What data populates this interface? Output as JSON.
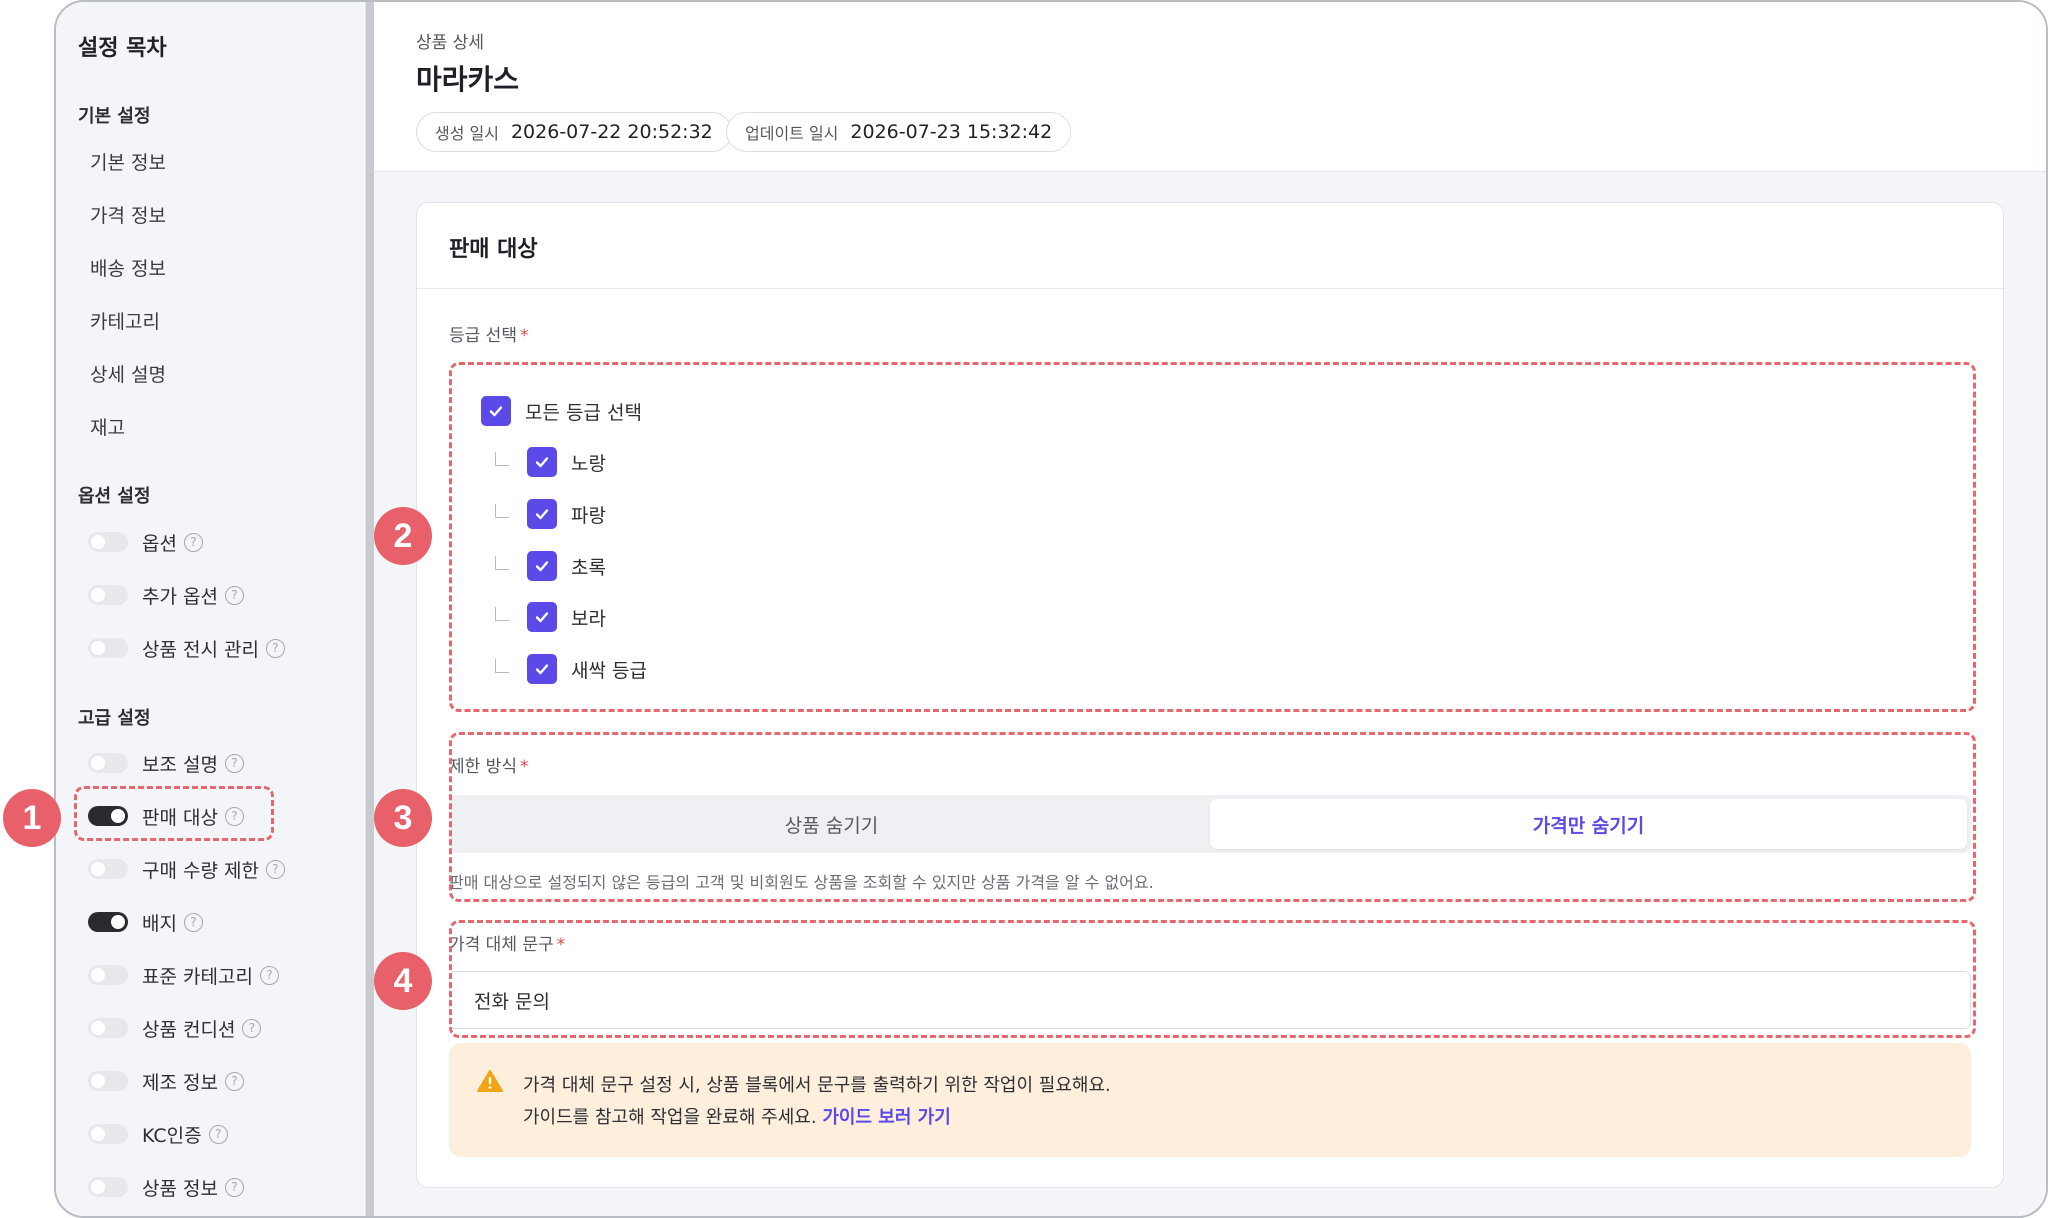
{
  "sidebar": {
    "title": "설정 목차",
    "basic_section": "기본 설정",
    "basic_items": [
      "기본 정보",
      "가격 정보",
      "배송 정보",
      "카테고리",
      "상세 설명",
      "재고"
    ],
    "option_section": "옵션 설정",
    "option_items": [
      {
        "label": "옵션",
        "on": false
      },
      {
        "label": "추가 옵션",
        "on": false
      },
      {
        "label": "상품 전시 관리",
        "on": false
      }
    ],
    "advanced_section": "고급 설정",
    "advanced_items": [
      {
        "label": "보조 설명",
        "on": false
      },
      {
        "label": "판매 대상",
        "on": true
      },
      {
        "label": "구매 수량 제한",
        "on": false
      },
      {
        "label": "배지",
        "on": true
      },
      {
        "label": "표준 카테고리",
        "on": false
      },
      {
        "label": "상품 컨디션",
        "on": false
      },
      {
        "label": "제조 정보",
        "on": false
      },
      {
        "label": "KC인증",
        "on": false
      },
      {
        "label": "상품 정보",
        "on": false
      }
    ],
    "help_glyph": "?"
  },
  "header": {
    "breadcrumb": "상품 상세",
    "title": "마라카스",
    "created_label": "생성 일시",
    "created_value": "2026-07-22 20:52:32",
    "updated_label": "업데이트 일시",
    "updated_value": "2026-07-23 15:32:42"
  },
  "card": {
    "title": "판매 대상",
    "grade_label": "등급 선택",
    "required_mark": "*",
    "all_grades": "모든 등급 선택",
    "grades": [
      "노랑",
      "파랑",
      "초록",
      "보라",
      "새싹 등급"
    ],
    "restriction_label": "제한 방식",
    "seg_options": [
      "상품 숨기기",
      "가격만 숨기기"
    ],
    "seg_selected": "가격만 숨기기",
    "hint": "판매 대상으로 설정되지 않은 등급의 고객 및 비회원도 상품을 조회할 수 있지만 상품 가격을 알 수 없어요.",
    "replace_label": "가격 대체 문구",
    "replace_value": "전화 문의",
    "alert_line1": "가격 대체 문구 설정 시, 상품 블록에서 문구를 출력하기 위한 작업이 필요해요.",
    "alert_line2": "가이드를 참고해 작업을 완료해 주세요.",
    "alert_link": "가이드 보러 가기"
  },
  "annotations": [
    "1",
    "2",
    "3",
    "4"
  ],
  "colors": {
    "accent": "#5b4ae8",
    "annotation": "#e8606a",
    "toggle_on": "#2a2b30",
    "alert_bg": "#fdefdc",
    "alert_icon": "#f2a413"
  }
}
